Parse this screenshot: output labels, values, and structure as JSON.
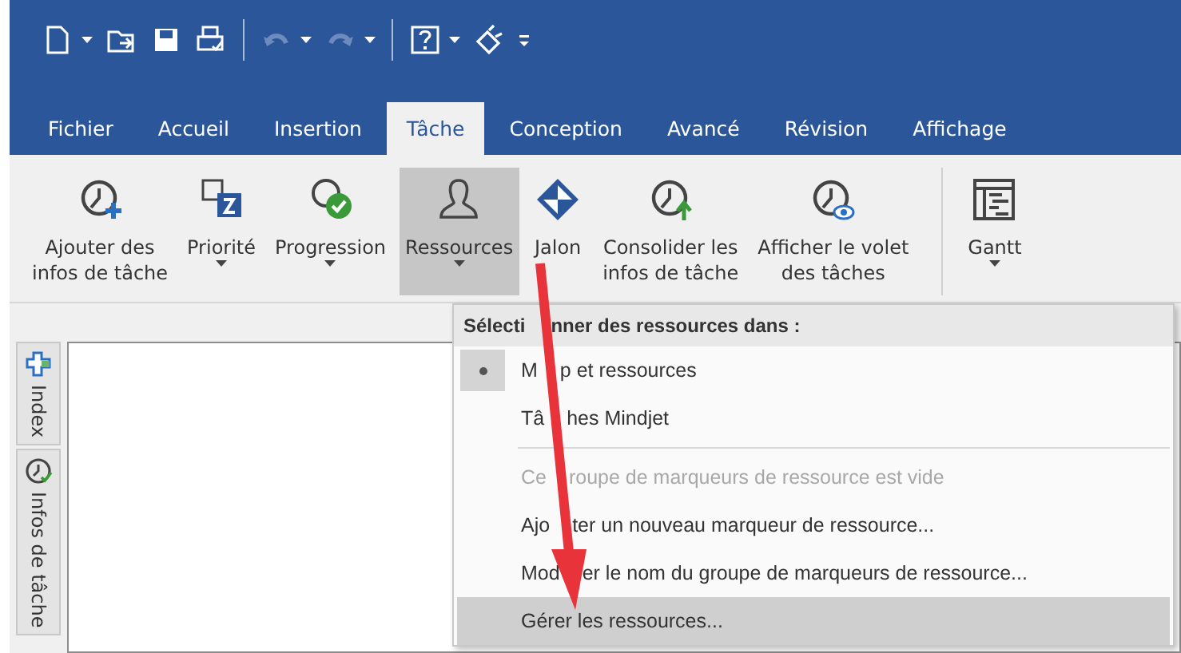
{
  "quick_access": [
    {
      "kind": "new",
      "caret": true
    },
    {
      "kind": "open",
      "caret": false
    },
    {
      "kind": "save",
      "caret": false
    },
    {
      "kind": "print",
      "caret": false
    },
    {
      "kind": "sep"
    },
    {
      "kind": "undo",
      "caret": true
    },
    {
      "kind": "redo",
      "caret": true
    },
    {
      "kind": "sep"
    },
    {
      "kind": "help",
      "caret": true
    },
    {
      "kind": "brush",
      "caret": false
    },
    {
      "kind": "more",
      "caret": false
    }
  ],
  "tabs": [
    {
      "label": "Fichier",
      "selected": false
    },
    {
      "label": "Accueil",
      "selected": false
    },
    {
      "label": "Insertion",
      "selected": false
    },
    {
      "label": "Tâche",
      "selected": true
    },
    {
      "label": "Conception",
      "selected": false
    },
    {
      "label": "Avancé",
      "selected": false
    },
    {
      "label": "Révision",
      "selected": false
    },
    {
      "label": "Affichage",
      "selected": false
    }
  ],
  "ribbon": [
    {
      "kind": "clock-plus",
      "lines": [
        "Ajouter des",
        "infos de tâche"
      ],
      "dropdown": false,
      "selected": false
    },
    {
      "kind": "priority",
      "lines": [
        "Priorité"
      ],
      "dropdown": true,
      "selected": false
    },
    {
      "kind": "progress",
      "lines": [
        "Progression"
      ],
      "dropdown": true,
      "selected": false
    },
    {
      "kind": "person",
      "lines": [
        "Ressources"
      ],
      "dropdown": true,
      "selected": true
    },
    {
      "kind": "diamond",
      "lines": [
        "Jalon"
      ],
      "dropdown": false,
      "selected": false
    },
    {
      "kind": "clock-up",
      "lines": [
        "Consolider les",
        "infos de tâche"
      ],
      "dropdown": false,
      "selected": false
    },
    {
      "kind": "clock-eye",
      "lines": [
        "Afficher le volet",
        "des tâches"
      ],
      "dropdown": false,
      "selected": false
    },
    {
      "kind": "gantt",
      "lines": [
        "Gantt"
      ],
      "dropdown": true,
      "selected": false
    }
  ],
  "side_tabs": [
    {
      "kind": "index",
      "label": "Index"
    },
    {
      "kind": "clock",
      "label": "Infos de tâche"
    }
  ],
  "menu": {
    "header_parts": [
      "Sélecti",
      "nner des ressources dans :"
    ],
    "items": [
      {
        "kind": "radio",
        "label_parts": [
          "M",
          "p et ressources"
        ],
        "selected": true,
        "disabled": false
      },
      {
        "kind": "radio",
        "label_parts": [
          "Tâ",
          "hes Mindjet"
        ],
        "selected": false,
        "disabled": false
      },
      {
        "kind": "separator"
      },
      {
        "kind": "item",
        "label_parts": [
          "Ce",
          "roupe de marqueurs de ressource est vide"
        ],
        "selected": false,
        "disabled": true
      },
      {
        "kind": "item",
        "label_parts": [
          "Ajo",
          "ter un nouveau marqueur de ressource..."
        ],
        "selected": false,
        "disabled": false
      },
      {
        "kind": "item",
        "label_parts": [
          "Mod",
          "er le nom du groupe de marqueurs de ressource..."
        ],
        "selected": false,
        "disabled": false
      },
      {
        "kind": "item",
        "label_parts": [
          "Gérer les ressources..."
        ],
        "selected": true,
        "disabled": false
      }
    ]
  }
}
